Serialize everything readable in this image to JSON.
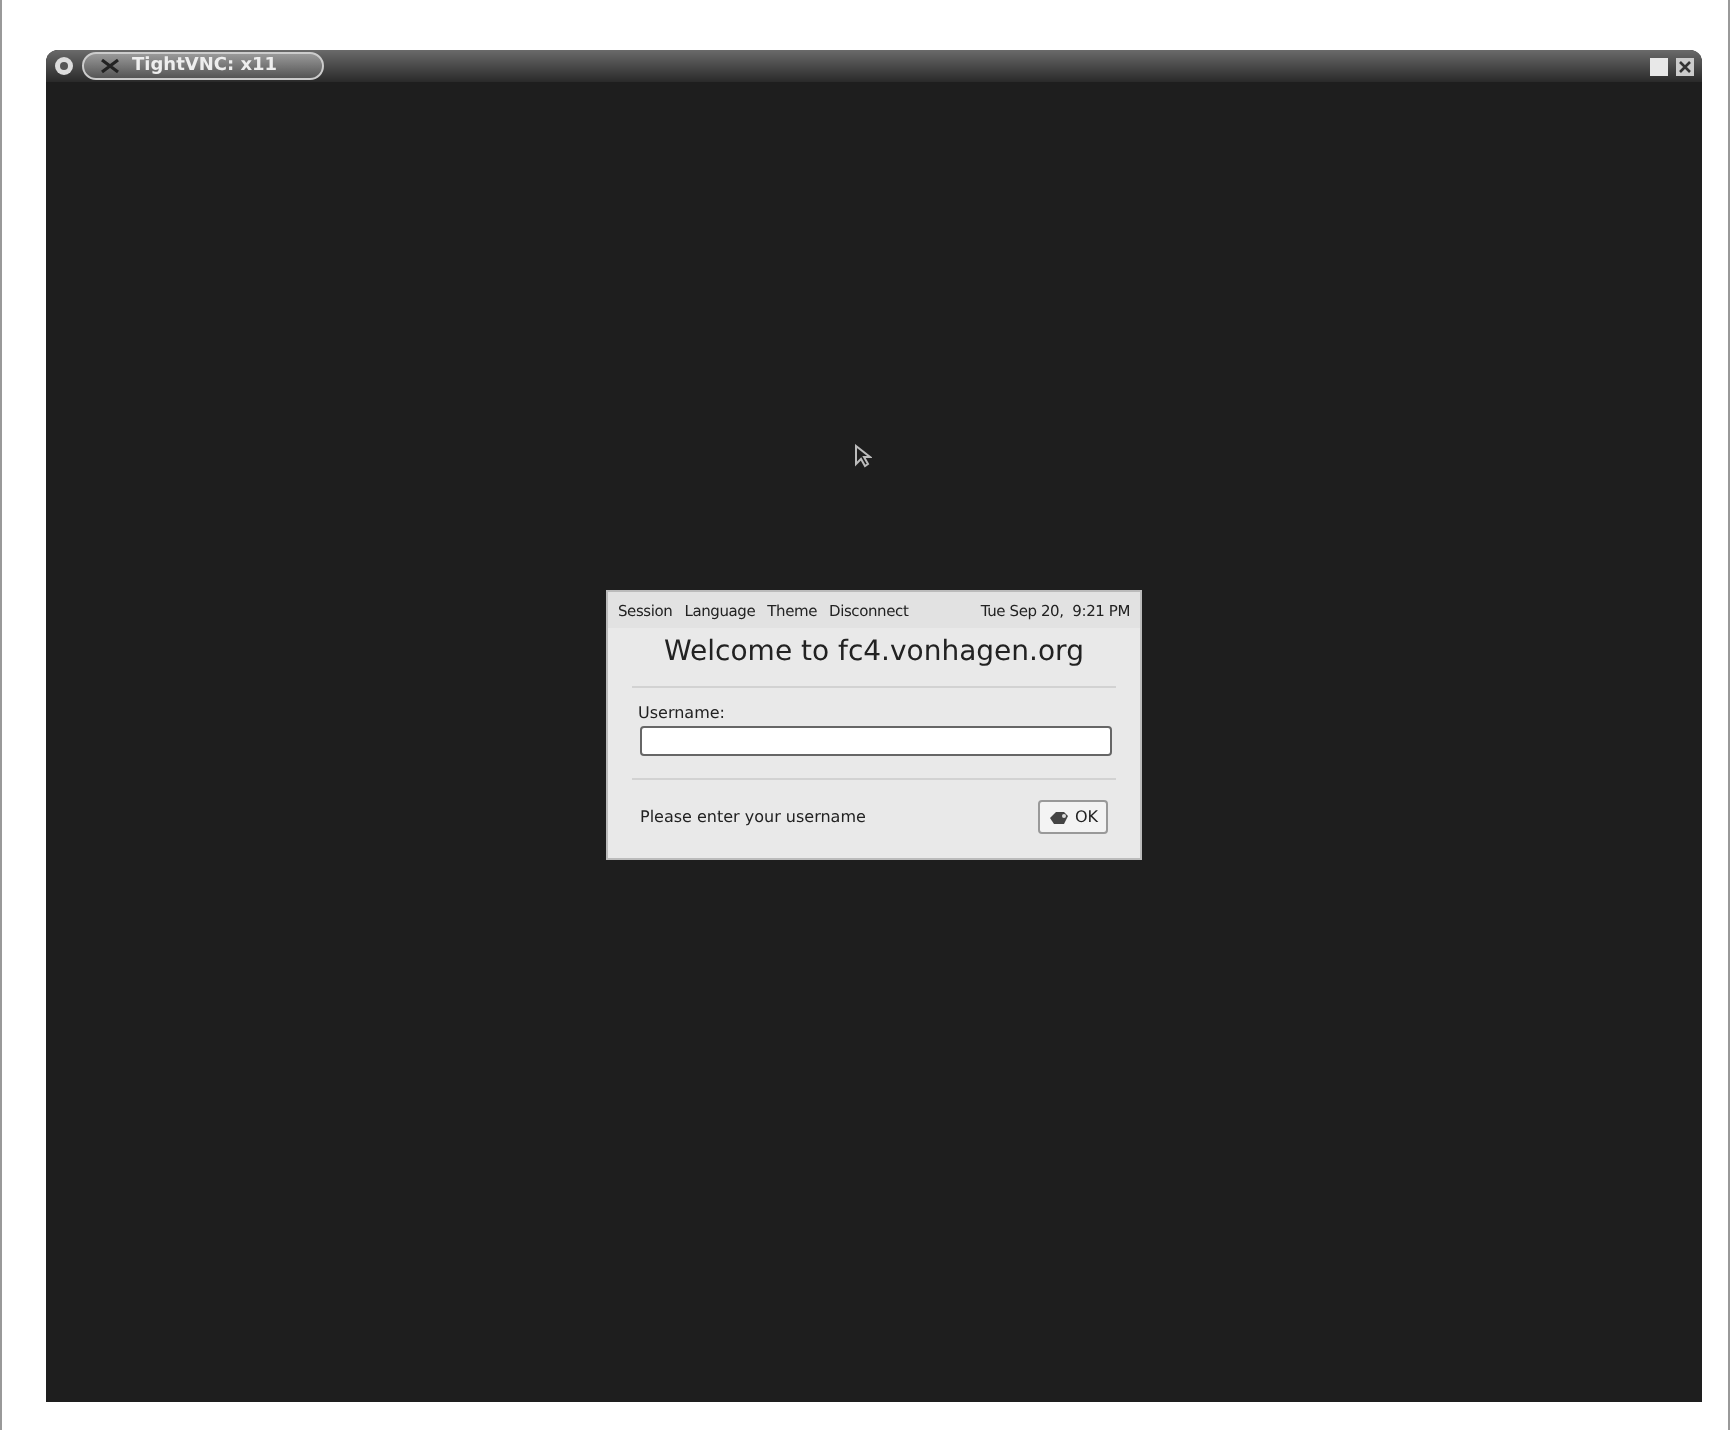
{
  "window": {
    "title": "TightVNC: x11"
  },
  "login": {
    "menu": [
      {
        "label": "Session"
      },
      {
        "label": "Language"
      },
      {
        "label": "Theme"
      },
      {
        "label": "Disconnect"
      }
    ],
    "clock": "Tue Sep 20,  9:21 PM",
    "welcome": "Welcome to fc4.vonhagen.org",
    "field_label": "Username:",
    "message": "Please enter your username",
    "ok_button": "OK"
  }
}
